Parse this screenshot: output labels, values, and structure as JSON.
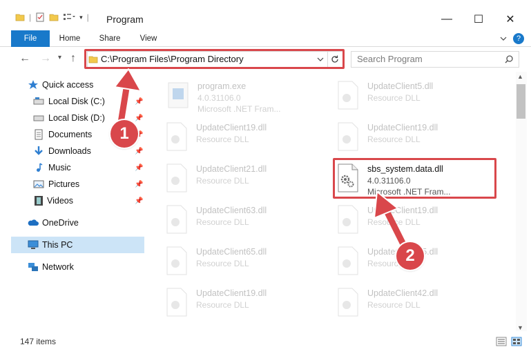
{
  "window": {
    "title": "Program",
    "controls": {
      "minimize": "—",
      "maximize": "☐",
      "close": "✕"
    }
  },
  "ribbon": {
    "tabs": [
      "File",
      "Home",
      "Share",
      "View"
    ],
    "help": "?"
  },
  "address": {
    "path": "C:\\Program Files\\Program Directory",
    "search_placeholder": "Search Program"
  },
  "sidebar": {
    "items": [
      {
        "label": "Quick access",
        "icon": "star-icon"
      },
      {
        "label": "Local Disk (C:)",
        "icon": "drive-icon",
        "pinned": true
      },
      {
        "label": "Local Disk (D:)",
        "icon": "drive-icon",
        "pinned": true
      },
      {
        "label": "Documents",
        "icon": "documents-icon",
        "pinned": true
      },
      {
        "label": "Downloads",
        "icon": "downloads-icon",
        "pinned": true
      },
      {
        "label": "Music",
        "icon": "music-icon",
        "pinned": true
      },
      {
        "label": "Pictures",
        "icon": "pictures-icon",
        "pinned": true
      },
      {
        "label": "Videos",
        "icon": "videos-icon",
        "pinned": true
      },
      {
        "label": "OneDrive",
        "icon": "onedrive-icon"
      },
      {
        "label": "This PC",
        "icon": "pc-icon",
        "selected": true
      },
      {
        "label": "Network",
        "icon": "network-icon"
      }
    ]
  },
  "files": [
    {
      "name": "program.exe",
      "line1": "4.0.31106.0",
      "line2": "Microsoft .NET Fram...",
      "faded": true
    },
    {
      "name": "UpdateClient5.dll",
      "line1": "Resource DLL",
      "line2": "",
      "faded": true
    },
    {
      "name": "UpdateClient19.dll",
      "line1": "Resource DLL",
      "line2": "",
      "faded": true
    },
    {
      "name": "UpdateClient19.dll",
      "line1": "Resource DLL",
      "line2": "",
      "faded": true
    },
    {
      "name": "UpdateClient21.dll",
      "line1": "Resource DLL",
      "line2": "",
      "faded": true
    },
    {
      "name": "sbs_system.data.dll",
      "line1": "4.0.31106.0",
      "line2": "Microsoft .NET Fram...",
      "faded": false
    },
    {
      "name": "UpdateClient63.dll",
      "line1": "Resource DLL",
      "line2": "",
      "faded": true
    },
    {
      "name": "UpdateClient19.dll",
      "line1": "Resource DLL",
      "line2": "",
      "faded": true
    },
    {
      "name": "UpdateClient65.dll",
      "line1": "Resource DLL",
      "line2": "",
      "faded": true
    },
    {
      "name": "UpdateClient65.dll",
      "line1": "Resource DLL",
      "line2": "",
      "faded": true
    },
    {
      "name": "UpdateClient19.dll",
      "line1": "Resource DLL",
      "line2": "",
      "faded": true
    },
    {
      "name": "UpdateClient42.dll",
      "line1": "Resource DLL",
      "line2": "",
      "faded": true
    }
  ],
  "status": {
    "item_count": "147 items"
  },
  "annotations": {
    "step1": "1",
    "step2": "2",
    "color": "#d9474b"
  }
}
